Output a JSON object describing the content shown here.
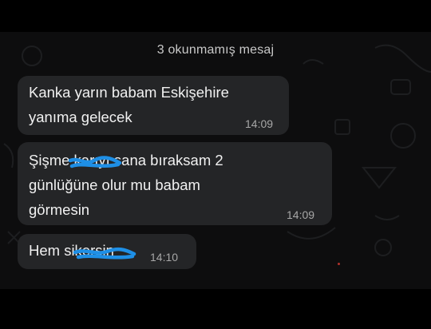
{
  "banner": {
    "unread_label": "3 okunmamış mesaj"
  },
  "messages": [
    {
      "lines": [
        "Kanka yarın babam Eskişehire",
        "yanıma gelecek"
      ],
      "time": "14:09"
    },
    {
      "lines": [
        "Şişme karıyı sana bıraksam 2",
        "günlüğüne olur mu babam",
        "görmesin"
      ],
      "time": "14:09"
    },
    {
      "lines": [
        "Hem sikersin"
      ],
      "time": "14:10"
    }
  ],
  "colors": {
    "background": "#0d0d0e",
    "bubble": "#242527",
    "text": "#f1f1f1",
    "timestamp": "#a7a7a7",
    "scribble": "#1e8fe6"
  }
}
